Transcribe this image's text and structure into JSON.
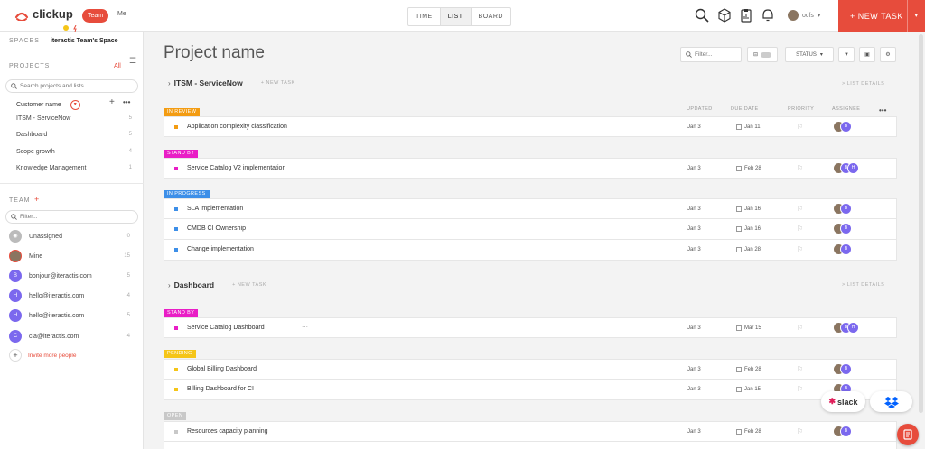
{
  "topbar": {
    "logo_text": "clickup",
    "team_label": "Team",
    "me_label": "Me",
    "view_tabs": [
      {
        "label": "TIME",
        "active": false
      },
      {
        "label": "LIST",
        "active": true
      },
      {
        "label": "BOARD",
        "active": false
      }
    ],
    "user_label": "ocfs",
    "new_task_label": "+ NEW TASK",
    "icons": [
      "search-icon",
      "cube-icon",
      "clipboard-icon",
      "bell-icon"
    ]
  },
  "sidebar": {
    "spaces_label": "SPACES",
    "space_name": "iteractis Team's Space",
    "projects_label": "PROJECTS",
    "all_label": "All",
    "project_search_placeholder": "Search projects and lists",
    "customer_label": "Customer name",
    "projects": [
      {
        "name": "ITSM - ServiceNow",
        "count": "5"
      },
      {
        "name": "Dashboard",
        "count": "5"
      },
      {
        "name": "Scope growth",
        "count": "4"
      },
      {
        "name": "Knowledge Management",
        "count": "1"
      }
    ],
    "team_label": "TEAM",
    "team_filter_placeholder": "Filter...",
    "members": [
      {
        "name": "Unassigned",
        "count": "0",
        "initial": "",
        "type": "unassigned"
      },
      {
        "name": "Mine",
        "count": "15",
        "initial": "",
        "type": "photo"
      },
      {
        "name": "bonjour@iteractis.com",
        "count": "5",
        "initial": "B",
        "type": "letter"
      },
      {
        "name": "hello@iteractis.com",
        "count": "4",
        "initial": "H",
        "type": "letter"
      },
      {
        "name": "hello@iteractis.com",
        "count": "5",
        "initial": "H",
        "type": "letter"
      },
      {
        "name": "cla@iteractis.com",
        "count": "4",
        "initial": "C",
        "type": "letter"
      }
    ],
    "invite_label": "Invite more people"
  },
  "main": {
    "title": "Project name",
    "filter_placeholder": "Filter...",
    "status_label": "STATUS",
    "columns": {
      "updated": "UPDATED",
      "due": "DUE DATE",
      "priority": "PRIORITY",
      "assignee": "ASSIGNEE"
    },
    "groups": [
      {
        "name": "ITSM - ServiceNow",
        "new_task": "+ NEW TASK",
        "list_details": "> LIST DETAILS"
      },
      {
        "name": "Dashboard",
        "new_task": "+ NEW TASK",
        "list_details": "> LIST DETAILS"
      }
    ],
    "statuses": [
      {
        "label": "IN REVIEW",
        "color": "#f39c12"
      },
      {
        "label": "STAND BY",
        "color": "#e91ec6"
      },
      {
        "label": "IN PROGRESS",
        "color": "#3d8fe8"
      },
      {
        "label": "STAND BY",
        "color": "#e91ec6"
      },
      {
        "label": "PENDING",
        "color": "#f5c518"
      },
      {
        "label": "OPEN",
        "color": "#c8c8c8"
      }
    ],
    "tasks": [
      {
        "name": "Application complexity classification",
        "updated": "Jan 3",
        "due": "Jan 11",
        "color": "#f39c12",
        "assignees": 2
      },
      {
        "name": "Service Catalog V2 implementation",
        "updated": "Jan 3",
        "due": "Feb 28",
        "color": "#e91ec6",
        "assignees": 3
      },
      {
        "name": "SLA implementation",
        "updated": "Jan 3",
        "due": "Jan 16",
        "color": "#3d8fe8",
        "assignees": 2
      },
      {
        "name": "CMDB CI Ownership",
        "updated": "Jan 3",
        "due": "Jan 16",
        "color": "#3d8fe8",
        "assignees": 2
      },
      {
        "name": "Change implementation",
        "updated": "Jan 3",
        "due": "Jan 28",
        "color": "#3d8fe8",
        "assignees": 2
      },
      {
        "name": "Service Catalog Dashboard",
        "updated": "Jan 3",
        "due": "Mar 15",
        "color": "#e91ec6",
        "assignees": 3
      },
      {
        "name": "Global Billing Dashboard",
        "updated": "Jan 3",
        "due": "Feb 28",
        "color": "#f5c518",
        "assignees": 2
      },
      {
        "name": "Billing Dashboard for CI",
        "updated": "Jan 3",
        "due": "Jan 15",
        "color": "#f5c518",
        "assignees": 2
      },
      {
        "name": "Resources capacity planning",
        "updated": "Jan 3",
        "due": "Feb 28",
        "color": "#c8c8c8",
        "assignees": 2
      }
    ],
    "slack_label": "slack"
  }
}
